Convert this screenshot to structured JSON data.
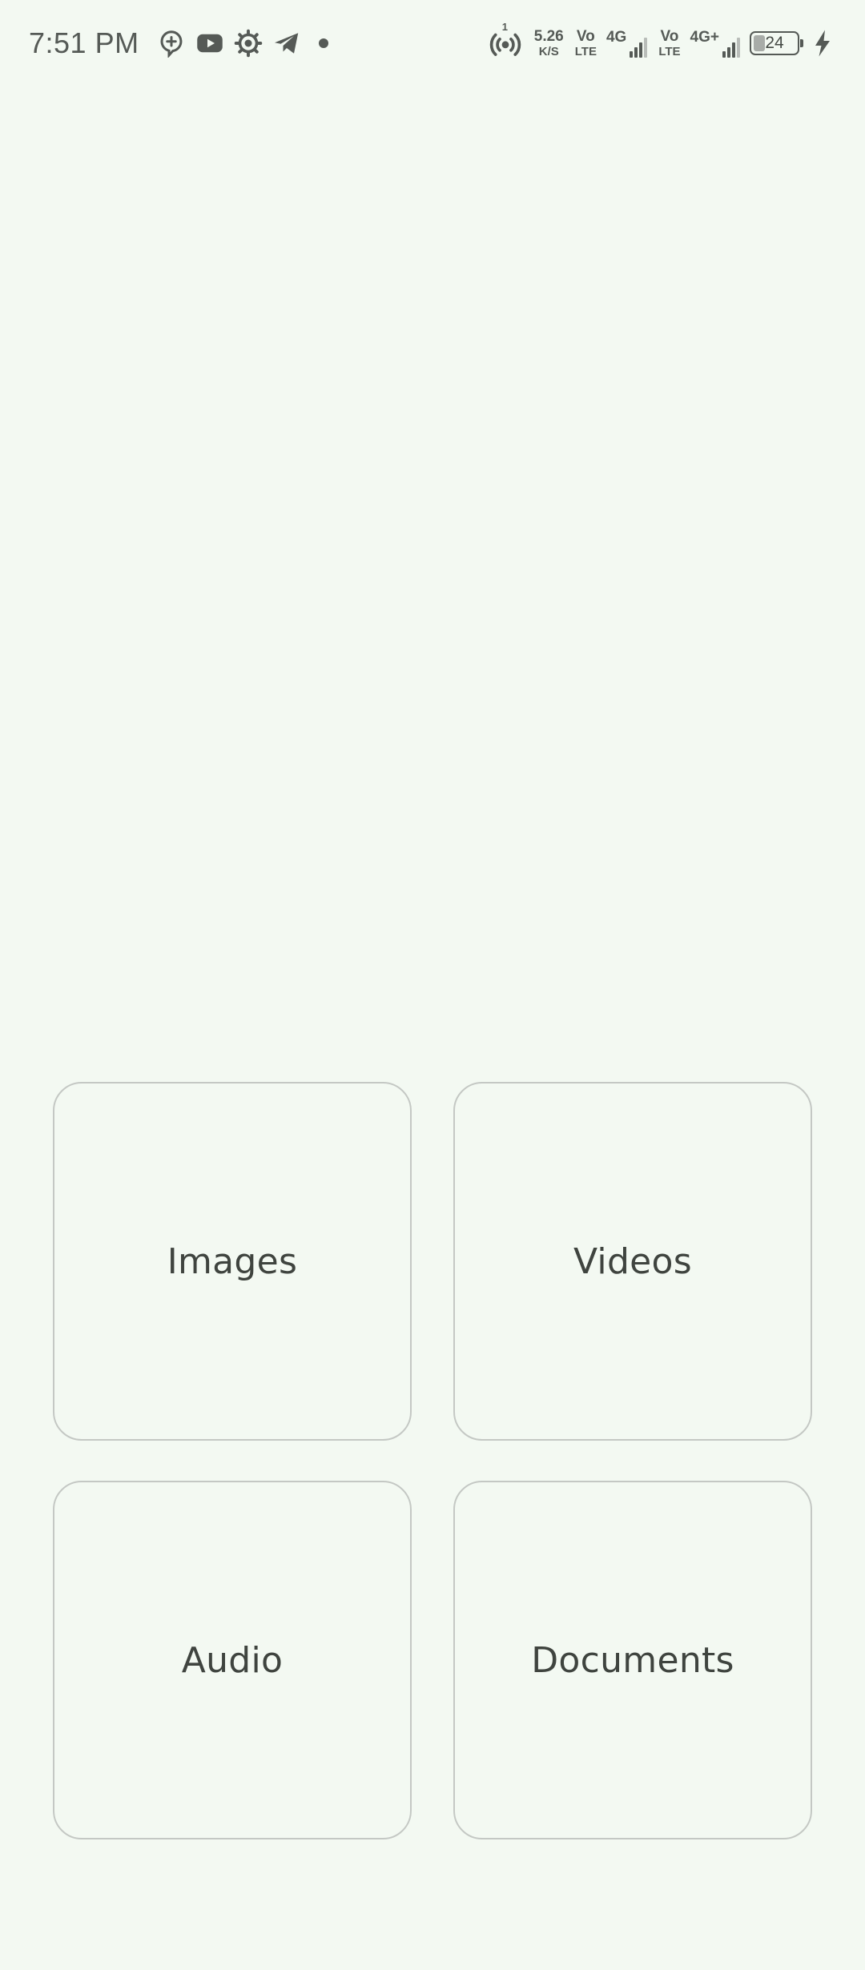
{
  "status_bar": {
    "time": "7:51 PM",
    "notification_icons": [
      "chat-bubble-plus-icon",
      "youtube-icon",
      "settings-gear-icon",
      "telegram-icon"
    ],
    "hotspot_badge": "1",
    "net_speed": {
      "value": "5.26",
      "unit": "K/S"
    },
    "volte_1": {
      "top": "Vo",
      "bottom": "LTE"
    },
    "network_1_label": "4G",
    "volte_2": {
      "top": "Vo",
      "bottom": "LTE"
    },
    "network_2_label": "4G+",
    "battery_level": "24",
    "charging": true
  },
  "categories": [
    {
      "label": "Images"
    },
    {
      "label": "Videos"
    },
    {
      "label": "Audio"
    },
    {
      "label": "Documents"
    }
  ],
  "colors": {
    "background": "#f3f9f2",
    "tile_border": "#c4c8c4",
    "text": "#3f443f",
    "status_icons": "#555a56"
  }
}
